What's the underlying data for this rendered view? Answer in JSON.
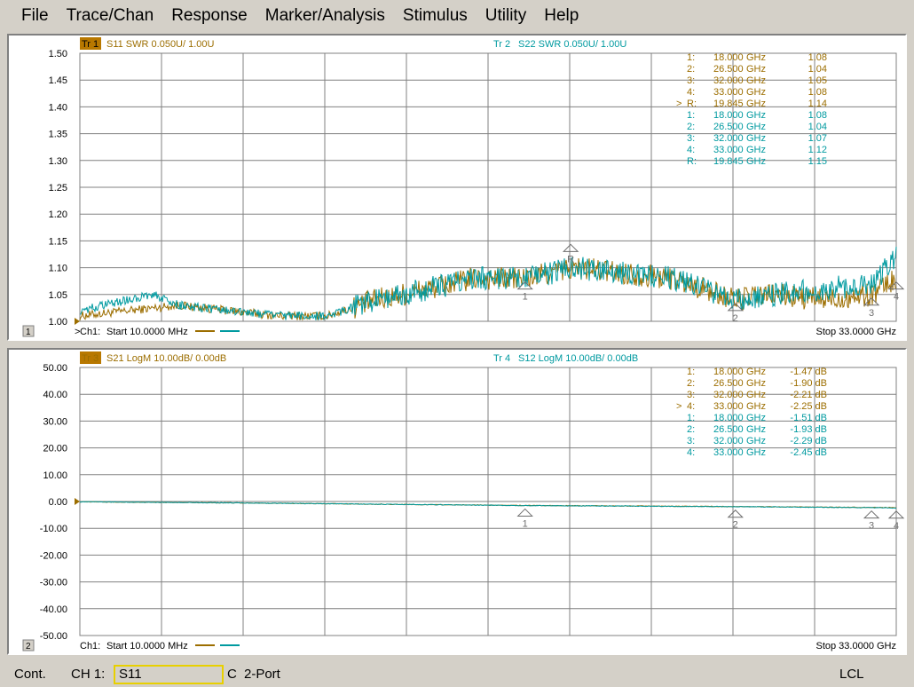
{
  "menu": [
    "File",
    "Trace/Chan",
    "Response",
    "Marker/Analysis",
    "Stimulus",
    "Utility",
    "Help"
  ],
  "colors": {
    "tr1": "#9c6e00",
    "tr2": "#009aa0",
    "grid": "#808080",
    "mark": "#6e6e6e"
  },
  "panels": [
    {
      "window_number": "1",
      "trace_a": {
        "tag": "Tr 1",
        "label": "S11 SWR 0.050U/  1.00U"
      },
      "trace_b": {
        "tag": "Tr 2",
        "label": "S22 SWR 0.050U/  1.00U"
      },
      "y_ticks": [
        "1.50",
        "1.45",
        "1.40",
        "1.35",
        "1.30",
        "1.25",
        "1.20",
        "1.15",
        "1.10",
        "1.05",
        "1.00"
      ],
      "y_range": [
        1.0,
        1.5
      ],
      "channel": "Ch1:",
      "start": "Start  10.0000 MHz",
      "stop": "Stop  33.0000 GHz",
      "active_arrow": ">",
      "marker_table": [
        {
          "trace": "a",
          "active": "",
          "num": "1:",
          "freq": "18.000",
          "unit": "GHz",
          "val": "1.08"
        },
        {
          "trace": "a",
          "active": "",
          "num": "2:",
          "freq": "26.500",
          "unit": "GHz",
          "val": "1.04"
        },
        {
          "trace": "a",
          "active": "",
          "num": "3:",
          "freq": "32.000",
          "unit": "GHz",
          "val": "1.05"
        },
        {
          "trace": "a",
          "active": "",
          "num": "4:",
          "freq": "33.000",
          "unit": "GHz",
          "val": "1.08"
        },
        {
          "trace": "a",
          "active": ">",
          "num": "R:",
          "freq": "19.845",
          "unit": "GHz",
          "val": "1.14"
        },
        {
          "trace": "b",
          "active": "",
          "num": "1:",
          "freq": "18.000",
          "unit": "GHz",
          "val": "1.08"
        },
        {
          "trace": "b",
          "active": "",
          "num": "2:",
          "freq": "26.500",
          "unit": "GHz",
          "val": "1.04"
        },
        {
          "trace": "b",
          "active": "",
          "num": "3:",
          "freq": "32.000",
          "unit": "GHz",
          "val": "1.07"
        },
        {
          "trace": "b",
          "active": "",
          "num": "4:",
          "freq": "33.000",
          "unit": "GHz",
          "val": "1.12"
        },
        {
          "trace": "b",
          "active": "",
          "num": "R:",
          "freq": "19.845",
          "unit": "GHz",
          "val": "1.15"
        }
      ],
      "chart_markers": [
        {
          "label": "1",
          "freq": 18.0,
          "value": 1.08
        },
        {
          "label": "2",
          "freq": 26.5,
          "value": 1.04
        },
        {
          "label": "3",
          "freq": 32.0,
          "value": 1.05
        },
        {
          "label": "4",
          "freq": 33.0,
          "value": 1.08
        },
        {
          "label": "R",
          "freq": 19.845,
          "value": 1.15
        }
      ]
    },
    {
      "window_number": "2",
      "trace_a": {
        "tag": "Tr 3",
        "label": "S21 LogM 10.00dB/  0.00dB"
      },
      "trace_b": {
        "tag": "Tr 4",
        "label": "S12 LogM 10.00dB/  0.00dB"
      },
      "y_ticks": [
        "50.00",
        "40.00",
        "30.00",
        "20.00",
        "10.00",
        "0.00",
        "-10.00",
        "-20.00",
        "-30.00",
        "-40.00",
        "-50.00"
      ],
      "y_range": [
        -50,
        50
      ],
      "channel": "Ch1:",
      "start": "Start  10.0000 MHz",
      "stop": "Stop  33.0000 GHz",
      "active_arrow": "",
      "marker_table": [
        {
          "trace": "a",
          "active": "",
          "num": "1:",
          "freq": "18.000",
          "unit": "GHz",
          "val": "-1.47 dB"
        },
        {
          "trace": "a",
          "active": "",
          "num": "2:",
          "freq": "26.500",
          "unit": "GHz",
          "val": "-1.90 dB"
        },
        {
          "trace": "a",
          "active": "",
          "num": "3:",
          "freq": "32.000",
          "unit": "GHz",
          "val": "-2.21 dB"
        },
        {
          "trace": "a",
          "active": ">",
          "num": "4:",
          "freq": "33.000",
          "unit": "GHz",
          "val": "-2.25 dB"
        },
        {
          "trace": "b",
          "active": "",
          "num": "1:",
          "freq": "18.000",
          "unit": "GHz",
          "val": "-1.51 dB"
        },
        {
          "trace": "b",
          "active": "",
          "num": "2:",
          "freq": "26.500",
          "unit": "GHz",
          "val": "-1.93 dB"
        },
        {
          "trace": "b",
          "active": "",
          "num": "3:",
          "freq": "32.000",
          "unit": "GHz",
          "val": "-2.29 dB"
        },
        {
          "trace": "b",
          "active": "",
          "num": "4:",
          "freq": "33.000",
          "unit": "GHz",
          "val": "-2.45 dB"
        }
      ],
      "chart_markers": [
        {
          "label": "1",
          "freq": 18.0,
          "value": -1.47
        },
        {
          "label": "2",
          "freq": 26.5,
          "value": -1.9
        },
        {
          "label": "3",
          "freq": 32.0,
          "value": -2.21
        },
        {
          "label": "4",
          "freq": 33.0,
          "value": -2.25
        }
      ]
    }
  ],
  "chart_data": [
    {
      "type": "line",
      "x_range_ghz": [
        0.01,
        33.0
      ],
      "ylim": [
        1.0,
        1.5
      ],
      "grid": true,
      "series": [
        {
          "name": "S11 SWR",
          "trace": "Tr 1",
          "shape_points": [
            [
              0.01,
              1.01
            ],
            [
              2,
              1.02
            ],
            [
              4,
              1.03
            ],
            [
              6,
              1.02
            ],
            [
              8,
              1.01
            ],
            [
              10,
              1.01
            ],
            [
              12,
              1.04
            ],
            [
              14,
              1.06
            ],
            [
              16,
              1.08
            ],
            [
              18,
              1.08
            ],
            [
              20,
              1.1
            ],
            [
              22,
              1.09
            ],
            [
              24,
              1.08
            ],
            [
              26.5,
              1.04
            ],
            [
              28,
              1.05
            ],
            [
              30,
              1.04
            ],
            [
              32,
              1.05
            ],
            [
              33,
              1.08
            ]
          ]
        },
        {
          "name": "S22 SWR",
          "trace": "Tr 2",
          "shape_points": [
            [
              0.01,
              1.02
            ],
            [
              2,
              1.04
            ],
            [
              3,
              1.05
            ],
            [
              4,
              1.03
            ],
            [
              6,
              1.02
            ],
            [
              8,
              1.01
            ],
            [
              10,
              1.01
            ],
            [
              12,
              1.04
            ],
            [
              14,
              1.06
            ],
            [
              16,
              1.08
            ],
            [
              18,
              1.08
            ],
            [
              20,
              1.1
            ],
            [
              22,
              1.09
            ],
            [
              24,
              1.08
            ],
            [
              26.5,
              1.04
            ],
            [
              28,
              1.05
            ],
            [
              30,
              1.06
            ],
            [
              32,
              1.07
            ],
            [
              33,
              1.12
            ]
          ]
        }
      ]
    },
    {
      "type": "line",
      "x_range_ghz": [
        0.01,
        33.0
      ],
      "ylim": [
        -50,
        50
      ],
      "grid": true,
      "series": [
        {
          "name": "S21 LogM",
          "trace": "Tr 3",
          "shape_points": [
            [
              0.01,
              -0.1
            ],
            [
              6,
              -0.5
            ],
            [
              12,
              -1.0
            ],
            [
              18,
              -1.47
            ],
            [
              26.5,
              -1.9
            ],
            [
              32,
              -2.21
            ],
            [
              33,
              -2.25
            ]
          ]
        },
        {
          "name": "S12 LogM",
          "trace": "Tr 4",
          "shape_points": [
            [
              0.01,
              -0.1
            ],
            [
              6,
              -0.5
            ],
            [
              12,
              -1.0
            ],
            [
              18,
              -1.51
            ],
            [
              26.5,
              -1.93
            ],
            [
              32,
              -2.29
            ],
            [
              33,
              -2.45
            ]
          ]
        }
      ]
    }
  ],
  "status": {
    "mode": "Cont.",
    "channel": "CH 1:",
    "param": "S11",
    "cal": "C",
    "port": "2-Port",
    "lcl": "LCL"
  }
}
